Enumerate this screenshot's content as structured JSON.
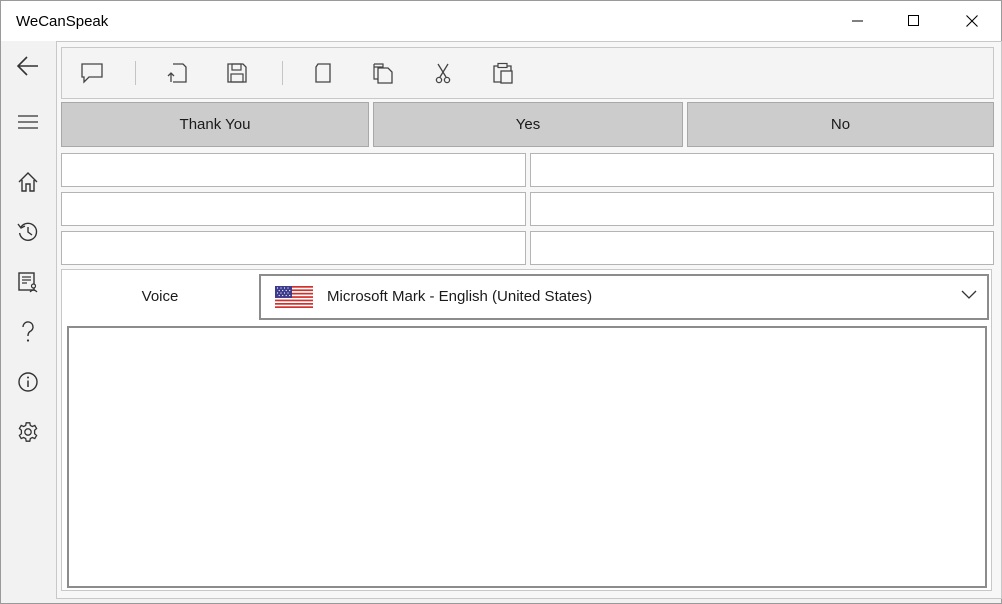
{
  "window": {
    "title": "WeCanSpeak"
  },
  "window_controls": [
    "minimize-icon",
    "maximize-icon",
    "close-icon"
  ],
  "sidebar": {
    "items": [
      {
        "icon": "back-arrow-icon"
      },
      {
        "icon": "hamburger-menu-icon"
      },
      {
        "icon": "home-icon"
      },
      {
        "icon": "history-icon"
      },
      {
        "icon": "document-user-icon"
      },
      {
        "icon": "question-mark-icon"
      },
      {
        "icon": "info-icon"
      },
      {
        "icon": "gear-icon"
      }
    ]
  },
  "toolbar": {
    "items": [
      "speech-bubble-icon",
      "open-file-icon",
      "save-icon",
      "new-document-icon",
      "copy-icon",
      "cut-icon",
      "paste-icon"
    ]
  },
  "phrases": {
    "thank_you": "Thank You",
    "yes": "Yes",
    "no": "No"
  },
  "phrase_slots": [
    [
      "",
      ""
    ],
    [
      "",
      ""
    ],
    [
      "",
      ""
    ]
  ],
  "voice": {
    "label": "Voice",
    "selected": "Microsoft Mark - English (United States)",
    "flag_icon": "us-flag-icon"
  },
  "speech_text": "",
  "colors": {
    "titlebar": "#ffffff",
    "background": "#f2f2f2",
    "phrase_button": "#cccccc",
    "icon_stroke": "#333333"
  }
}
